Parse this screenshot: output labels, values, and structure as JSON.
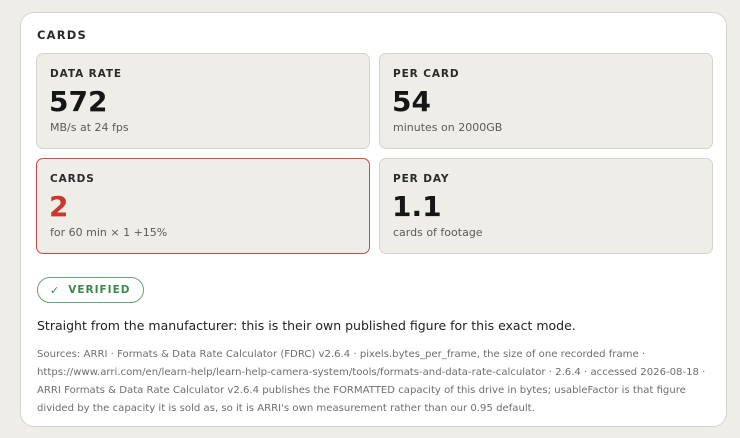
{
  "section": {
    "title": "CARDS"
  },
  "cards": [
    {
      "label": "DATA RATE",
      "value": "572",
      "sub": "MB/s at 24 fps"
    },
    {
      "label": "PER CARD",
      "value": "54",
      "sub": "minutes on 2000GB"
    },
    {
      "label": "CARDS",
      "value": "2",
      "sub": "for 60 min × 1 +15%"
    },
    {
      "label": "PER DAY",
      "value": "1.1",
      "sub": "cards of footage"
    }
  ],
  "badge": {
    "icon": "check-icon",
    "label": "VERIFIED"
  },
  "lead": "Straight from the manufacturer: this is their own published figure for this exact mode.",
  "sources": "Sources: ARRI · Formats & Data Rate Calculator (FDRC) v2.6.4 · pixels.bytes_per_frame, the size of one recorded frame · https://www.arri.com/en/learn-help/learn-help-camera-system/tools/formats-and-data-rate-calculator · 2.6.4 · accessed 2026-08-18 · ARRI Formats & Data Rate Calculator v2.6.4 publishes the FORMATTED capacity of this drive in bytes; usableFactor is that figure divided by the capacity it is sold as, so it is ARRI's own measurement rather than our 0.95 default.",
  "colors": {
    "background": "#efede8",
    "card": "#eeede8",
    "alert": "#c8382c",
    "verified": "#3c8a4a"
  }
}
